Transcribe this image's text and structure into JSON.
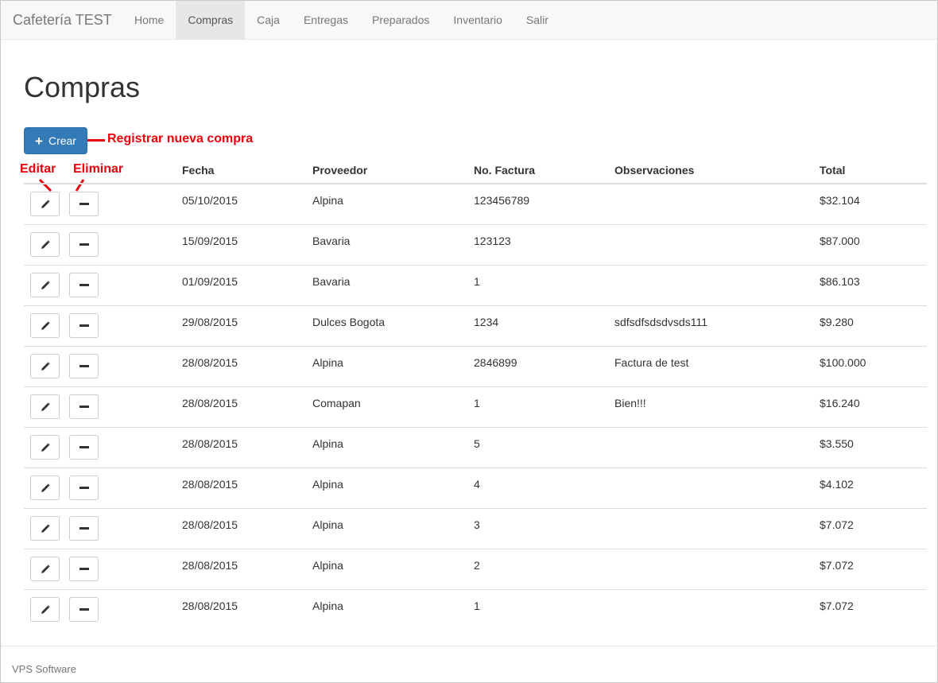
{
  "navbar": {
    "brand": "Cafetería TEST",
    "items": [
      {
        "label": "Home",
        "active": false
      },
      {
        "label": "Compras",
        "active": true
      },
      {
        "label": "Caja",
        "active": false
      },
      {
        "label": "Entregas",
        "active": false
      },
      {
        "label": "Preparados",
        "active": false
      },
      {
        "label": "Inventario",
        "active": false
      },
      {
        "label": "Salir",
        "active": false
      }
    ]
  },
  "page": {
    "title": "Compras",
    "create_label": "Crear",
    "create_icon": "plus-icon"
  },
  "annotations": {
    "create": "Registrar nueva compra",
    "edit": "Editar",
    "delete": "Eliminar",
    "color": "#e8000b"
  },
  "table": {
    "columns": [
      "Fecha",
      "Proveedor",
      "No. Factura",
      "Observaciones",
      "Total"
    ],
    "rows": [
      {
        "fecha": "05/10/2015",
        "proveedor": "Alpina",
        "factura": "123456789",
        "obs": "",
        "total": "$32.104"
      },
      {
        "fecha": "15/09/2015",
        "proveedor": "Bavaria",
        "factura": "123123",
        "obs": "",
        "total": "$87.000"
      },
      {
        "fecha": "01/09/2015",
        "proveedor": "Bavaria",
        "factura": "1",
        "obs": "",
        "total": "$86.103"
      },
      {
        "fecha": "29/08/2015",
        "proveedor": "Dulces Bogota",
        "factura": "1234",
        "obs": "sdfsdfsdsdvsds111",
        "total": "$9.280"
      },
      {
        "fecha": "28/08/2015",
        "proveedor": "Alpina",
        "factura": "2846899",
        "obs": "Factura de test",
        "total": "$100.000"
      },
      {
        "fecha": "28/08/2015",
        "proveedor": "Comapan",
        "factura": "1",
        "obs": "Bien!!!",
        "total": "$16.240"
      },
      {
        "fecha": "28/08/2015",
        "proveedor": "Alpina",
        "factura": "5",
        "obs": "",
        "total": "$3.550"
      },
      {
        "fecha": "28/08/2015",
        "proveedor": "Alpina",
        "factura": "4",
        "obs": "",
        "total": "$4.102"
      },
      {
        "fecha": "28/08/2015",
        "proveedor": "Alpina",
        "factura": "3",
        "obs": "",
        "total": "$7.072"
      },
      {
        "fecha": "28/08/2015",
        "proveedor": "Alpina",
        "factura": "2",
        "obs": "",
        "total": "$7.072"
      },
      {
        "fecha": "28/08/2015",
        "proveedor": "Alpina",
        "factura": "1",
        "obs": "",
        "total": "$7.072"
      }
    ]
  },
  "footer": {
    "text": "VPS Software"
  },
  "colors": {
    "primary": "#337ab7",
    "navbar_bg": "#f8f8f8"
  }
}
